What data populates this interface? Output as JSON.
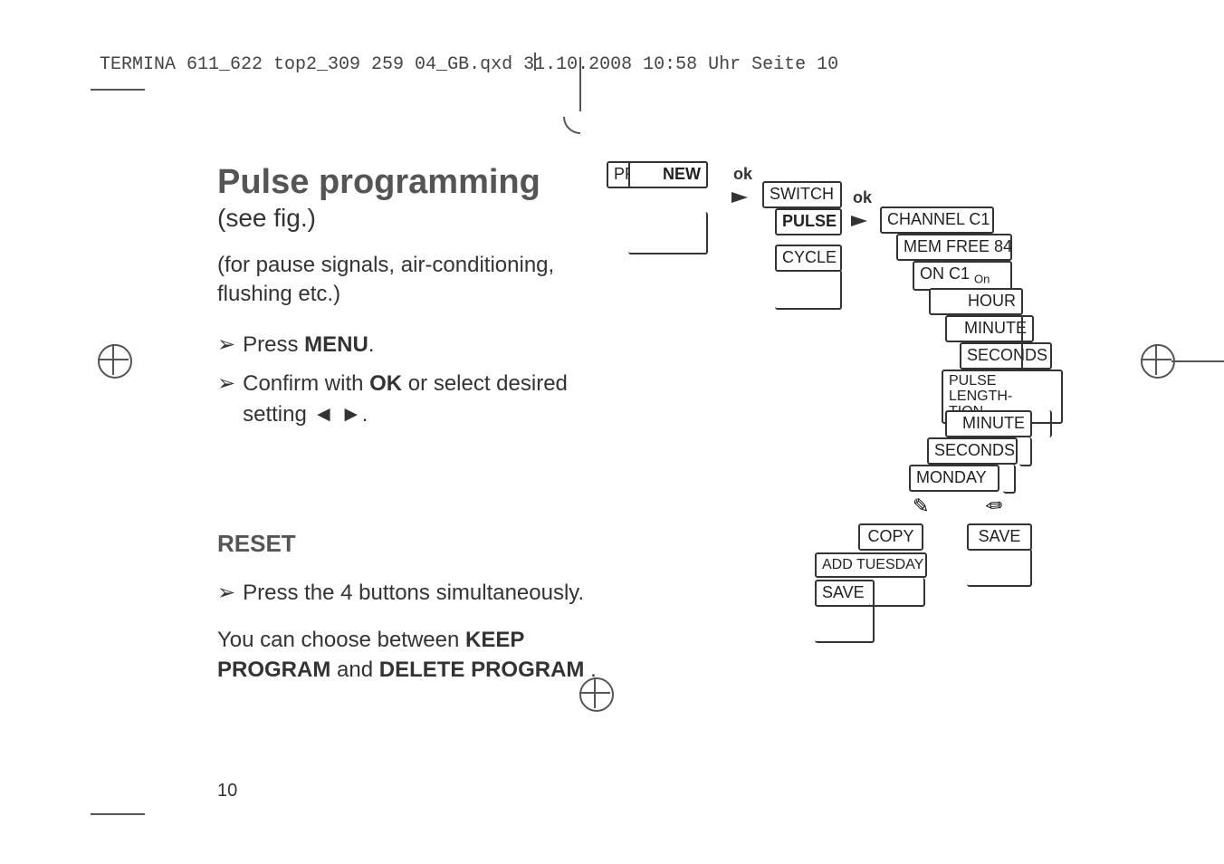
{
  "header": "TERMINA 611_622 top2_309 259 04_GB.qxd  31.10.2008  10:58 Uhr  Seite 10",
  "page_number": "10",
  "main": {
    "title": "Pulse programming",
    "subtitle": "(see fig.)",
    "intro": "(for pause signals, air-conditioning, flushing etc.)",
    "step1_pre": "Press ",
    "step1_bold": "MENU",
    "step1_post": ".",
    "step2_pre": "Confirm with ",
    "step2_bold": "OK",
    "step2_mid": " or select desired setting ",
    "step2_tri": "◄  ►",
    "step2_post": ".",
    "reset_heading": "RESET",
    "reset_step": "Press the 4 buttons simultaneously.",
    "choose_pre": "You can choose between ",
    "choose_b1": "KEEP PROGRAM",
    "choose_mid": " and ",
    "choose_b2": "DELETE PROGRAM",
    "choose_post": " ."
  },
  "diagram": {
    "program": "PROGRAM",
    "new": "NEW",
    "switch": "SWITCH",
    "pulse": "PULSE",
    "cycle": "CYCLE",
    "channel": "CHANNEL C1",
    "memfree": "MEM FREE 84",
    "onc1": "ON C1 ",
    "onc1_sub": "On",
    "hour": "HOUR",
    "minute1": "MINUTE",
    "seconds1": "SECONDS",
    "pulselen": "PULSE LENGTH-\nTION",
    "minute2": "MINUTE",
    "seconds2": "SECONDS",
    "monday": "MONDAY",
    "copy": "COPY",
    "save_r": "SAVE",
    "add_tue": "ADD TUESDAY",
    "save_l": "SAVE",
    "ok1": "ok",
    "ok2": "ok",
    "pencil_l": "✎",
    "pencil_r": "❥"
  }
}
